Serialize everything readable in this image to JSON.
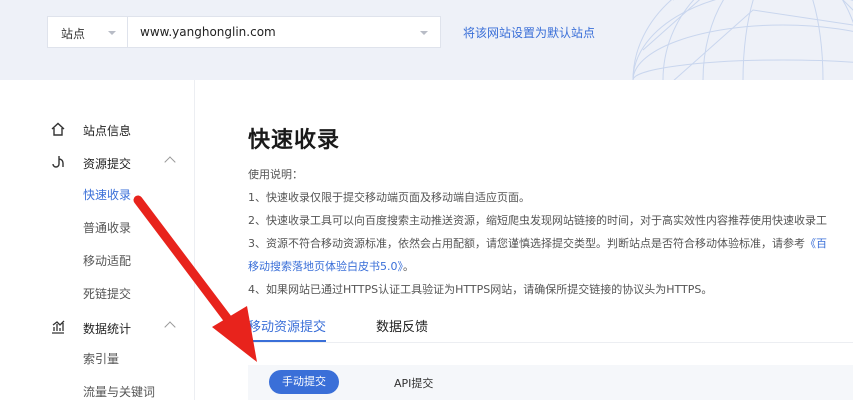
{
  "header": {
    "site_label": "站点",
    "site_url": "www.yanghonglin.com",
    "set_default_link": "将该网站设置为默认站点"
  },
  "sidebar": {
    "items": [
      {
        "label": "站点信息",
        "icon": "home-icon"
      },
      {
        "label": "资源提交",
        "icon": "submit-icon",
        "expanded": true,
        "children": [
          "快速收录",
          "普通收录",
          "移动适配",
          "死链提交"
        ],
        "active_child": "快速收录"
      },
      {
        "label": "数据统计",
        "icon": "chart-icon",
        "expanded": true,
        "children": [
          "索引量",
          "流量与关键词"
        ]
      }
    ]
  },
  "main": {
    "title": "快速收录",
    "usage_heading": "使用说明：",
    "lines": [
      "1、快速收录仅限于提交移动端页面及移动端自适应页面。",
      "2、快速收录工具可以向百度搜索主动推送资源，缩短爬虫发现网站链接的时间，对于高实效性内容推荐使用快速收录工",
      "3、资源不符合移动资源标准，依然会占用配额，请您谨慎选择提交类型。判断站点是否符合移动体验标准，请参考",
      "4、如果网站已通过HTTPS认证工具验证为HTTPS网站，请确保所提交链接的协议头为HTTPS。"
    ],
    "line3_link": "《百",
    "line3_cont": "移动搜索落地页体验白皮书5.0》",
    "line3_tail": "。",
    "tabs": [
      "移动资源提交",
      "数据反馈"
    ],
    "active_tab": "移动资源提交",
    "sub_tabs": [
      "手动提交",
      "API提交"
    ],
    "active_sub_tab": "手动提交"
  },
  "colors": {
    "accent": "#3a6fd8",
    "annotation_arrow": "#e8231c"
  }
}
